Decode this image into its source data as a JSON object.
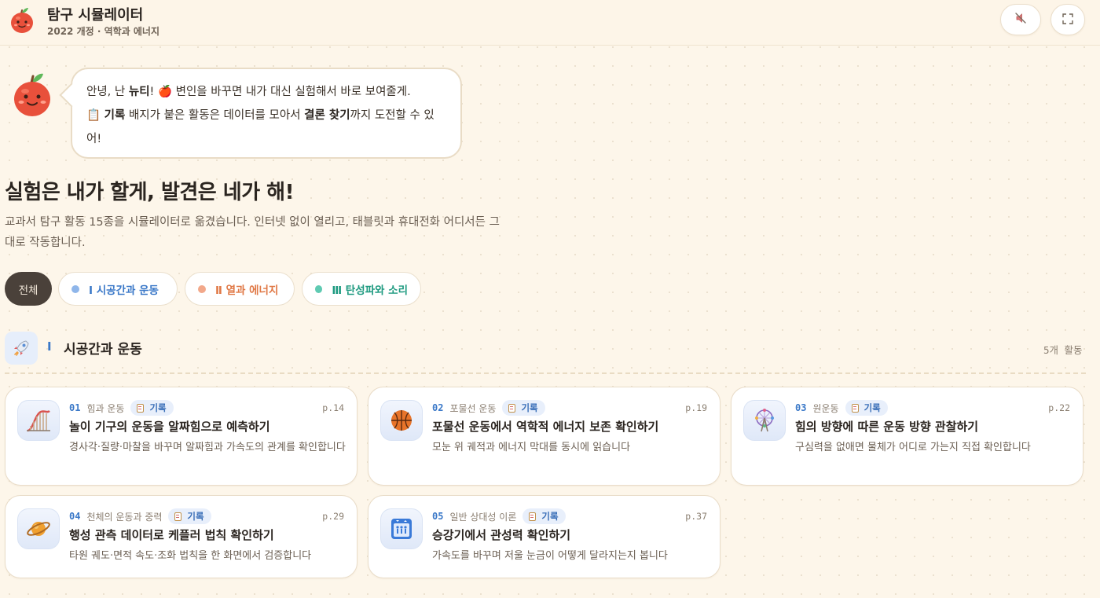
{
  "header": {
    "title": "탐구 시뮬레이터",
    "subtitle": "2022 개정 · 역학과 에너지",
    "logo_icon": "apple-icon",
    "mute_icon": "mute-icon",
    "fullscreen_icon": "fullscreen-icon"
  },
  "mascot": {
    "icon": "apple-mascot-icon",
    "line1_a": "안녕, 난 ",
    "line1_name": "뉴티",
    "line1_b": "! 🍎 변인을 바꾸면 내가 대신 실험해서 바로 보여줄게.",
    "line2_a": "📋 ",
    "line2_badge": "기록",
    "line2_b": " 배지가 붙은 활동은 데이터를 모아서 ",
    "line2_goal": "결론 찾기",
    "line2_c": "까지 도전할 수 있어!"
  },
  "hero": {
    "title": "실험은 내가 할게, 발견은 네가 해!",
    "description": "교과서 탐구 활동 15종을 시뮬레이터로 옮겼습니다. 인터넷 없이 열리고, 태블릿과 휴대전화 어디서든 그대로 작동합니다."
  },
  "filters": [
    {
      "label": "전체",
      "color": "#4a413a"
    },
    {
      "label": "Ⅰ 시공간과 운동",
      "color": "#8fb6ea"
    },
    {
      "label": "Ⅱ 열과 에너지",
      "color": "#f2a88a"
    },
    {
      "label": "Ⅲ 탄성파와 소리",
      "color": "#5fcab2"
    }
  ],
  "section": {
    "icon": "rocket-icon",
    "roman": "Ⅰ",
    "title": "시공간과 운동",
    "count": "5개 활동"
  },
  "cards": [
    {
      "num": "01",
      "unit": "힘과 운동",
      "badge": "기록",
      "page": "p.14",
      "title": "놀이 기구의 운동을 알짜힘으로 예측하기",
      "desc": "경사각·질량·마찰을 바꾸며 알짜힘과 가속도의 관계를 확인합니다",
      "icon": "rollercoaster-icon"
    },
    {
      "num": "02",
      "unit": "포물선 운동",
      "badge": "기록",
      "page": "p.19",
      "title": "포물선 운동에서 역학적 에너지 보존 확인하기",
      "desc": "모눈 위 궤적과 에너지 막대를 동시에 읽습니다",
      "icon": "basketball-icon"
    },
    {
      "num": "03",
      "unit": "원운동",
      "badge": "기록",
      "page": "p.22",
      "title": "힘의 방향에 따른 운동 방향 관찰하기",
      "desc": "구심력을 없애면 물체가 어디로 가는지 직접 확인합니다",
      "icon": "ferris-wheel-icon"
    },
    {
      "num": "04",
      "unit": "천체의 운동과 중력",
      "badge": "기록",
      "page": "p.29",
      "title": "행성 관측 데이터로 케플러 법칙 확인하기",
      "desc": "타원 궤도·면적 속도·조화 법칙을 한 화면에서 검증합니다",
      "icon": "planet-icon"
    },
    {
      "num": "05",
      "unit": "일반 상대성 이론",
      "badge": "기록",
      "page": "p.37",
      "title": "승강기에서 관성력 확인하기",
      "desc": "가속도를 바꾸며 저울 눈금이 어떻게 달라지는지 봅니다",
      "icon": "elevator-icon"
    }
  ]
}
